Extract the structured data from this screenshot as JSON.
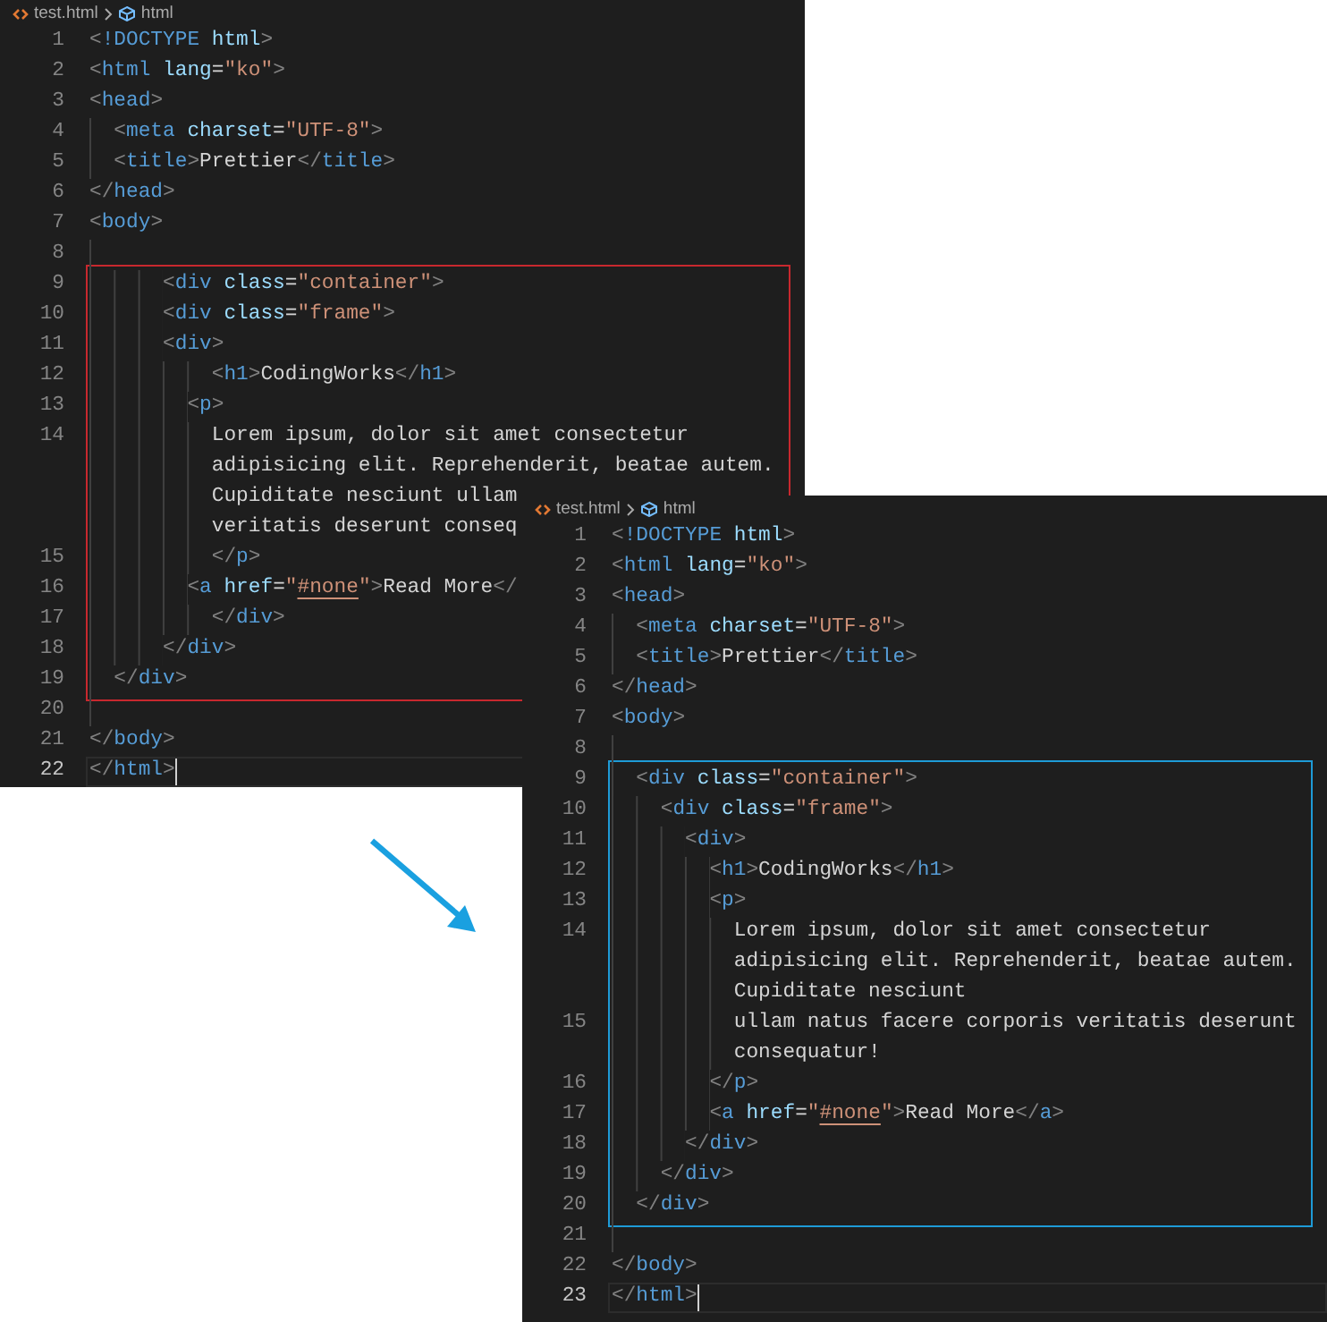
{
  "editors": [
    {
      "breadcrumb": {
        "file": "test.html",
        "symbol": "html"
      },
      "blocks": [
        {
          "kind": "plain",
          "lines": [
            {
              "number": "1",
              "rows": [
                {
                  "tokens": [
                    {
                      "text": "<",
                      "kind": "bracket"
                    },
                    {
                      "text": "!DOCTYPE",
                      "kind": "tag"
                    },
                    {
                      "text": " html",
                      "kind": "attr"
                    },
                    {
                      "text": ">",
                      "kind": "bracket"
                    }
                  ]
                }
              ]
            },
            {
              "number": "2",
              "rows": [
                {
                  "tokens": [
                    {
                      "text": "<",
                      "kind": "bracket"
                    },
                    {
                      "text": "html",
                      "kind": "tag"
                    },
                    {
                      "text": " lang",
                      "kind": "attr"
                    },
                    {
                      "text": "=",
                      "kind": "text"
                    },
                    {
                      "text": "\"ko\"",
                      "kind": "string"
                    },
                    {
                      "text": ">",
                      "kind": "bracket"
                    }
                  ]
                }
              ]
            },
            {
              "number": "3",
              "rows": [
                {
                  "tokens": [
                    {
                      "text": "<",
                      "kind": "bracket"
                    },
                    {
                      "text": "head",
                      "kind": "tag"
                    },
                    {
                      "text": ">",
                      "kind": "bracket"
                    }
                  ]
                }
              ]
            },
            {
              "number": "4",
              "rows": [
                {
                  "indent": "  ",
                  "tokens": [
                    {
                      "text": "<",
                      "kind": "bracket"
                    },
                    {
                      "text": "meta",
                      "kind": "tag"
                    },
                    {
                      "text": " charset",
                      "kind": "attr"
                    },
                    {
                      "text": "=",
                      "kind": "text"
                    },
                    {
                      "text": "\"UTF-8\"",
                      "kind": "string"
                    },
                    {
                      "text": ">",
                      "kind": "bracket"
                    }
                  ]
                }
              ]
            },
            {
              "number": "5",
              "rows": [
                {
                  "indent": "  ",
                  "tokens": [
                    {
                      "text": "<",
                      "kind": "bracket"
                    },
                    {
                      "text": "title",
                      "kind": "tag"
                    },
                    {
                      "text": ">",
                      "kind": "bracket"
                    },
                    {
                      "text": "Prettier",
                      "kind": "text"
                    },
                    {
                      "text": "</",
                      "kind": "bracket"
                    },
                    {
                      "text": "title",
                      "kind": "tag"
                    },
                    {
                      "text": ">",
                      "kind": "bracket"
                    }
                  ]
                }
              ]
            },
            {
              "number": "6",
              "rows": [
                {
                  "tokens": [
                    {
                      "text": "</",
                      "kind": "bracket"
                    },
                    {
                      "text": "head",
                      "kind": "tag"
                    },
                    {
                      "text": ">",
                      "kind": "bracket"
                    }
                  ]
                }
              ]
            },
            {
              "number": "7",
              "rows": [
                {
                  "tokens": [
                    {
                      "text": "<",
                      "kind": "bracket"
                    },
                    {
                      "text": "body",
                      "kind": "tag"
                    },
                    {
                      "text": ">",
                      "kind": "bracket"
                    }
                  ]
                }
              ]
            },
            {
              "number": "8",
              "rows": [
                {
                  "indent": "  "
                }
              ]
            }
          ]
        },
        {
          "kind": "boxed",
          "color": "#c8282e",
          "lines": [
            {
              "number": "9",
              "rows": [
                {
                  "indent": "      ",
                  "tokens": [
                    {
                      "text": "<",
                      "kind": "bracket"
                    },
                    {
                      "text": "div",
                      "kind": "tag"
                    },
                    {
                      "text": " class",
                      "kind": "attr"
                    },
                    {
                      "text": "=",
                      "kind": "text"
                    },
                    {
                      "text": "\"container\"",
                      "kind": "string"
                    },
                    {
                      "text": ">",
                      "kind": "bracket"
                    }
                  ]
                }
              ]
            },
            {
              "number": "10",
              "rows": [
                {
                  "indent": "      ",
                  "tokens": [
                    {
                      "text": "<",
                      "kind": "bracket"
                    },
                    {
                      "text": "div",
                      "kind": "tag"
                    },
                    {
                      "text": " class",
                      "kind": "attr"
                    },
                    {
                      "text": "=",
                      "kind": "text"
                    },
                    {
                      "text": "\"frame\"",
                      "kind": "string"
                    },
                    {
                      "text": ">",
                      "kind": "bracket"
                    }
                  ]
                }
              ]
            },
            {
              "number": "11",
              "rows": [
                {
                  "indent": "      ",
                  "tokens": [
                    {
                      "text": "<",
                      "kind": "bracket"
                    },
                    {
                      "text": "div",
                      "kind": "tag"
                    },
                    {
                      "text": ">",
                      "kind": "bracket"
                    }
                  ]
                }
              ]
            },
            {
              "number": "12",
              "rows": [
                {
                  "indent": "          ",
                  "tokens": [
                    {
                      "text": "<",
                      "kind": "bracket"
                    },
                    {
                      "text": "h1",
                      "kind": "tag"
                    },
                    {
                      "text": ">",
                      "kind": "bracket"
                    },
                    {
                      "text": "CodingWorks",
                      "kind": "text"
                    },
                    {
                      "text": "</",
                      "kind": "bracket"
                    },
                    {
                      "text": "h1",
                      "kind": "tag"
                    },
                    {
                      "text": ">",
                      "kind": "bracket"
                    }
                  ]
                }
              ]
            },
            {
              "number": "13",
              "rows": [
                {
                  "indent": "        ",
                  "tokens": [
                    {
                      "text": "<",
                      "kind": "bracket"
                    },
                    {
                      "text": "p",
                      "kind": "tag"
                    },
                    {
                      "text": ">",
                      "kind": "bracket"
                    }
                  ]
                }
              ]
            },
            {
              "number": "14",
              "rows": [
                {
                  "indent": "          ",
                  "tokens": [
                    {
                      "text": "Lorem ipsum, dolor sit amet consectetur",
                      "kind": "text"
                    }
                  ]
                },
                {
                  "indent": "          ",
                  "tokens": [
                    {
                      "text": "adipisicing elit. Reprehenderit, beatae autem.",
                      "kind": "text"
                    }
                  ]
                },
                {
                  "indent": "          ",
                  "tokens": [
                    {
                      "text": "Cupiditate nesciunt ullam",
                      "kind": "text"
                    }
                  ]
                },
                {
                  "indent": "          ",
                  "tokens": [
                    {
                      "text": "veritatis deserunt conseq",
                      "kind": "text"
                    }
                  ]
                }
              ]
            },
            {
              "number": "15",
              "rows": [
                {
                  "indent": "          ",
                  "tokens": [
                    {
                      "text": "</",
                      "kind": "bracket"
                    },
                    {
                      "text": "p",
                      "kind": "tag"
                    },
                    {
                      "text": ">",
                      "kind": "bracket"
                    }
                  ]
                }
              ]
            },
            {
              "number": "16",
              "rows": [
                {
                  "indent": "        ",
                  "tokens": [
                    {
                      "text": "<",
                      "kind": "bracket"
                    },
                    {
                      "text": "a",
                      "kind": "tag"
                    },
                    {
                      "text": " href",
                      "kind": "attr"
                    },
                    {
                      "text": "=",
                      "kind": "text"
                    },
                    {
                      "text": "\"",
                      "kind": "string"
                    },
                    {
                      "text": "#none",
                      "kind": "link-string"
                    },
                    {
                      "text": "\"",
                      "kind": "string"
                    },
                    {
                      "text": ">",
                      "kind": "bracket"
                    },
                    {
                      "text": "Read More",
                      "kind": "text"
                    },
                    {
                      "text": "</",
                      "kind": "bracket"
                    }
                  ]
                }
              ]
            },
            {
              "number": "17",
              "rows": [
                {
                  "indent": "          ",
                  "tokens": [
                    {
                      "text": "</",
                      "kind": "bracket"
                    },
                    {
                      "text": "div",
                      "kind": "tag"
                    },
                    {
                      "text": ">",
                      "kind": "bracket"
                    }
                  ]
                }
              ]
            },
            {
              "number": "18",
              "rows": [
                {
                  "indent": "      ",
                  "tokens": [
                    {
                      "text": "</",
                      "kind": "bracket"
                    },
                    {
                      "text": "div",
                      "kind": "tag"
                    },
                    {
                      "text": ">",
                      "kind": "bracket"
                    }
                  ]
                }
              ]
            },
            {
              "number": "19",
              "rows": [
                {
                  "indent": "  ",
                  "tokens": [
                    {
                      "text": "</",
                      "kind": "bracket"
                    },
                    {
                      "text": "div",
                      "kind": "tag"
                    },
                    {
                      "text": ">",
                      "kind": "bracket"
                    }
                  ]
                }
              ]
            }
          ]
        },
        {
          "kind": "plain",
          "lines": [
            {
              "number": "20",
              "rows": [
                {
                  "indent": "  "
                }
              ]
            },
            {
              "number": "21",
              "rows": [
                {
                  "tokens": [
                    {
                      "text": "</",
                      "kind": "bracket"
                    },
                    {
                      "text": "body",
                      "kind": "tag"
                    },
                    {
                      "text": ">",
                      "kind": "bracket"
                    }
                  ]
                }
              ]
            },
            {
              "number": "22",
              "current": true,
              "rows": [
                {
                  "tokens": [
                    {
                      "text": "</",
                      "kind": "bracket"
                    },
                    {
                      "text": "html",
                      "kind": "tag"
                    },
                    {
                      "text": ">",
                      "kind": "bracket"
                    }
                  ]
                }
              ]
            }
          ]
        }
      ]
    },
    {
      "breadcrumb": {
        "file": "test.html",
        "symbol": "html"
      },
      "blocks": [
        {
          "kind": "plain",
          "lines": [
            {
              "number": "1",
              "rows": [
                {
                  "tokens": [
                    {
                      "text": "<",
                      "kind": "bracket"
                    },
                    {
                      "text": "!DOCTYPE",
                      "kind": "tag"
                    },
                    {
                      "text": " html",
                      "kind": "attr"
                    },
                    {
                      "text": ">",
                      "kind": "bracket"
                    }
                  ]
                }
              ]
            },
            {
              "number": "2",
              "rows": [
                {
                  "tokens": [
                    {
                      "text": "<",
                      "kind": "bracket"
                    },
                    {
                      "text": "html",
                      "kind": "tag"
                    },
                    {
                      "text": " lang",
                      "kind": "attr"
                    },
                    {
                      "text": "=",
                      "kind": "text"
                    },
                    {
                      "text": "\"ko\"",
                      "kind": "string"
                    },
                    {
                      "text": ">",
                      "kind": "bracket"
                    }
                  ]
                }
              ]
            },
            {
              "number": "3",
              "rows": [
                {
                  "tokens": [
                    {
                      "text": "<",
                      "kind": "bracket"
                    },
                    {
                      "text": "head",
                      "kind": "tag"
                    },
                    {
                      "text": ">",
                      "kind": "bracket"
                    }
                  ]
                }
              ]
            },
            {
              "number": "4",
              "rows": [
                {
                  "indent": "  ",
                  "tokens": [
                    {
                      "text": "<",
                      "kind": "bracket"
                    },
                    {
                      "text": "meta",
                      "kind": "tag"
                    },
                    {
                      "text": " charset",
                      "kind": "attr"
                    },
                    {
                      "text": "=",
                      "kind": "text"
                    },
                    {
                      "text": "\"UTF-8\"",
                      "kind": "string"
                    },
                    {
                      "text": ">",
                      "kind": "bracket"
                    }
                  ]
                }
              ]
            },
            {
              "number": "5",
              "rows": [
                {
                  "indent": "  ",
                  "tokens": [
                    {
                      "text": "<",
                      "kind": "bracket"
                    },
                    {
                      "text": "title",
                      "kind": "tag"
                    },
                    {
                      "text": ">",
                      "kind": "bracket"
                    },
                    {
                      "text": "Prettier",
                      "kind": "text"
                    },
                    {
                      "text": "</",
                      "kind": "bracket"
                    },
                    {
                      "text": "title",
                      "kind": "tag"
                    },
                    {
                      "text": ">",
                      "kind": "bracket"
                    }
                  ]
                }
              ]
            },
            {
              "number": "6",
              "rows": [
                {
                  "tokens": [
                    {
                      "text": "</",
                      "kind": "bracket"
                    },
                    {
                      "text": "head",
                      "kind": "tag"
                    },
                    {
                      "text": ">",
                      "kind": "bracket"
                    }
                  ]
                }
              ]
            },
            {
              "number": "7",
              "rows": [
                {
                  "tokens": [
                    {
                      "text": "<",
                      "kind": "bracket"
                    },
                    {
                      "text": "body",
                      "kind": "tag"
                    },
                    {
                      "text": ">",
                      "kind": "bracket"
                    }
                  ]
                }
              ]
            },
            {
              "number": "8",
              "rows": [
                {
                  "indent": "  "
                }
              ]
            }
          ]
        },
        {
          "kind": "boxed",
          "color": "#1e9bd7",
          "lines": [
            {
              "number": "9",
              "rows": [
                {
                  "indent": "  ",
                  "tokens": [
                    {
                      "text": "<",
                      "kind": "bracket"
                    },
                    {
                      "text": "div",
                      "kind": "tag"
                    },
                    {
                      "text": " class",
                      "kind": "attr"
                    },
                    {
                      "text": "=",
                      "kind": "text"
                    },
                    {
                      "text": "\"container\"",
                      "kind": "string"
                    },
                    {
                      "text": ">",
                      "kind": "bracket"
                    }
                  ]
                }
              ]
            },
            {
              "number": "10",
              "rows": [
                {
                  "indent": "    ",
                  "tokens": [
                    {
                      "text": "<",
                      "kind": "bracket"
                    },
                    {
                      "text": "div",
                      "kind": "tag"
                    },
                    {
                      "text": " class",
                      "kind": "attr"
                    },
                    {
                      "text": "=",
                      "kind": "text"
                    },
                    {
                      "text": "\"frame\"",
                      "kind": "string"
                    },
                    {
                      "text": ">",
                      "kind": "bracket"
                    }
                  ]
                }
              ]
            },
            {
              "number": "11",
              "rows": [
                {
                  "indent": "      ",
                  "tokens": [
                    {
                      "text": "<",
                      "kind": "bracket"
                    },
                    {
                      "text": "div",
                      "kind": "tag"
                    },
                    {
                      "text": ">",
                      "kind": "bracket"
                    }
                  ]
                }
              ]
            },
            {
              "number": "12",
              "rows": [
                {
                  "indent": "        ",
                  "tokens": [
                    {
                      "text": "<",
                      "kind": "bracket"
                    },
                    {
                      "text": "h1",
                      "kind": "tag"
                    },
                    {
                      "text": ">",
                      "kind": "bracket"
                    },
                    {
                      "text": "CodingWorks",
                      "kind": "text"
                    },
                    {
                      "text": "</",
                      "kind": "bracket"
                    },
                    {
                      "text": "h1",
                      "kind": "tag"
                    },
                    {
                      "text": ">",
                      "kind": "bracket"
                    }
                  ]
                }
              ]
            },
            {
              "number": "13",
              "rows": [
                {
                  "indent": "        ",
                  "tokens": [
                    {
                      "text": "<",
                      "kind": "bracket"
                    },
                    {
                      "text": "p",
                      "kind": "tag"
                    },
                    {
                      "text": ">",
                      "kind": "bracket"
                    }
                  ]
                }
              ]
            },
            {
              "number": "14",
              "rows": [
                {
                  "indent": "          ",
                  "tokens": [
                    {
                      "text": "Lorem ipsum, dolor sit amet consectetur",
                      "kind": "text"
                    }
                  ]
                },
                {
                  "indent": "          ",
                  "tokens": [
                    {
                      "text": "adipisicing elit. Reprehenderit, beatae autem.",
                      "kind": "text"
                    }
                  ]
                },
                {
                  "indent": "          ",
                  "tokens": [
                    {
                      "text": "Cupiditate nesciunt",
                      "kind": "text"
                    }
                  ]
                }
              ]
            },
            {
              "number": "15",
              "rows": [
                {
                  "indent": "          ",
                  "tokens": [
                    {
                      "text": "ullam natus facere corporis veritatis deserunt",
                      "kind": "text"
                    }
                  ]
                },
                {
                  "indent": "          ",
                  "tokens": [
                    {
                      "text": "consequatur!",
                      "kind": "text"
                    }
                  ]
                }
              ]
            },
            {
              "number": "16",
              "rows": [
                {
                  "indent": "        ",
                  "tokens": [
                    {
                      "text": "</",
                      "kind": "bracket"
                    },
                    {
                      "text": "p",
                      "kind": "tag"
                    },
                    {
                      "text": ">",
                      "kind": "bracket"
                    }
                  ]
                }
              ]
            },
            {
              "number": "17",
              "rows": [
                {
                  "indent": "        ",
                  "tokens": [
                    {
                      "text": "<",
                      "kind": "bracket"
                    },
                    {
                      "text": "a",
                      "kind": "tag"
                    },
                    {
                      "text": " href",
                      "kind": "attr"
                    },
                    {
                      "text": "=",
                      "kind": "text"
                    },
                    {
                      "text": "\"",
                      "kind": "string"
                    },
                    {
                      "text": "#none",
                      "kind": "link-string"
                    },
                    {
                      "text": "\"",
                      "kind": "string"
                    },
                    {
                      "text": ">",
                      "kind": "bracket"
                    },
                    {
                      "text": "Read More",
                      "kind": "text"
                    },
                    {
                      "text": "</",
                      "kind": "bracket"
                    },
                    {
                      "text": "a",
                      "kind": "tag"
                    },
                    {
                      "text": ">",
                      "kind": "bracket"
                    }
                  ]
                }
              ]
            },
            {
              "number": "18",
              "rows": [
                {
                  "indent": "      ",
                  "tokens": [
                    {
                      "text": "</",
                      "kind": "bracket"
                    },
                    {
                      "text": "div",
                      "kind": "tag"
                    },
                    {
                      "text": ">",
                      "kind": "bracket"
                    }
                  ]
                }
              ]
            },
            {
              "number": "19",
              "rows": [
                {
                  "indent": "    ",
                  "tokens": [
                    {
                      "text": "</",
                      "kind": "bracket"
                    },
                    {
                      "text": "div",
                      "kind": "tag"
                    },
                    {
                      "text": ">",
                      "kind": "bracket"
                    }
                  ]
                }
              ]
            },
            {
              "number": "20",
              "rows": [
                {
                  "indent": "  ",
                  "tokens": [
                    {
                      "text": "</",
                      "kind": "bracket"
                    },
                    {
                      "text": "div",
                      "kind": "tag"
                    },
                    {
                      "text": ">",
                      "kind": "bracket"
                    }
                  ]
                }
              ]
            }
          ]
        },
        {
          "kind": "plain",
          "lines": [
            {
              "number": "21",
              "rows": [
                {
                  "indent": "  "
                }
              ]
            },
            {
              "number": "22",
              "rows": [
                {
                  "tokens": [
                    {
                      "text": "</",
                      "kind": "bracket"
                    },
                    {
                      "text": "body",
                      "kind": "tag"
                    },
                    {
                      "text": ">",
                      "kind": "bracket"
                    }
                  ]
                }
              ]
            },
            {
              "number": "23",
              "current": true,
              "rows": [
                {
                  "tokens": [
                    {
                      "text": "</",
                      "kind": "bracket"
                    },
                    {
                      "text": "html",
                      "kind": "tag"
                    },
                    {
                      "text": ">",
                      "kind": "bracket"
                    }
                  ]
                }
              ]
            }
          ]
        }
      ]
    }
  ]
}
